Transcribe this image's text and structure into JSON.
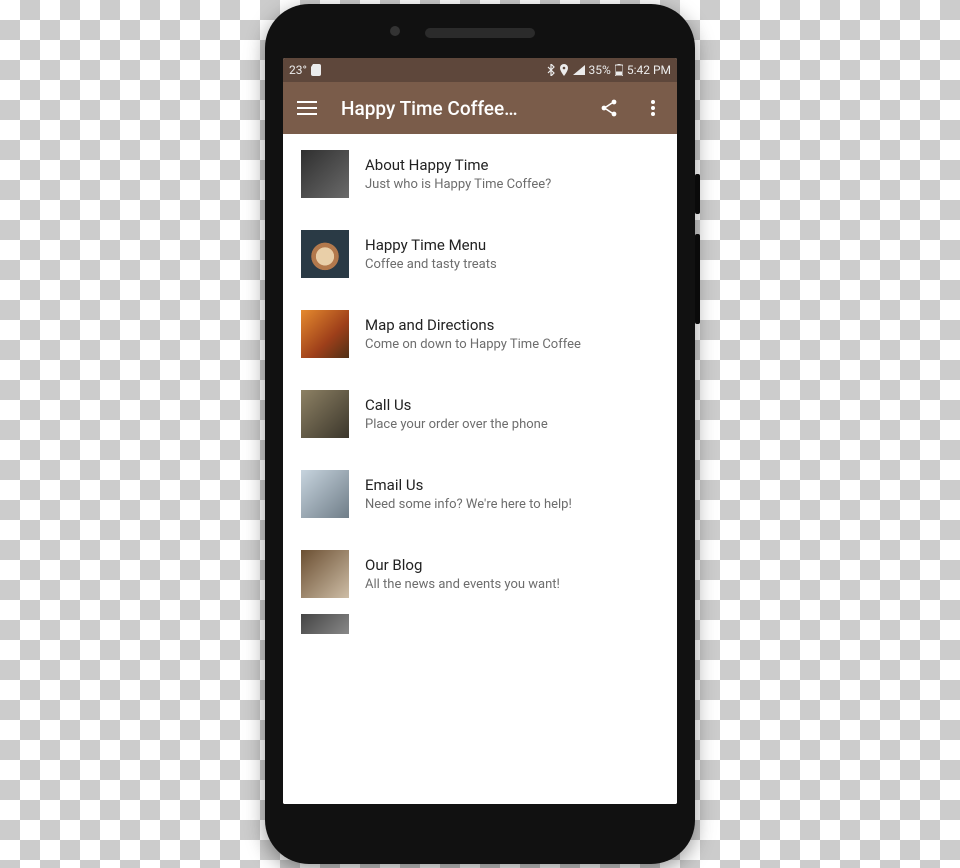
{
  "status_bar": {
    "temperature": "23°",
    "battery_percent": "35%",
    "clock": "5:42 PM"
  },
  "app_bar": {
    "title": "Happy Time Coffee…"
  },
  "menu": [
    {
      "title": "About Happy Time",
      "subtitle": "Just who is Happy Time Coffee?",
      "icon": "coffee-shop-photo"
    },
    {
      "title": "Happy Time Menu",
      "subtitle": "Coffee and tasty treats",
      "icon": "latte-photo"
    },
    {
      "title": "Map and Directions",
      "subtitle": "Come on down to Happy Time Coffee",
      "icon": "map-photo"
    },
    {
      "title": "Call Us",
      "subtitle": "Place your order over the phone",
      "icon": "keypad-photo"
    },
    {
      "title": "Email Us",
      "subtitle": "Need some info? We're here to help!",
      "icon": "laptop-photo"
    },
    {
      "title": "Our Blog",
      "subtitle": "All the news and events you want!",
      "icon": "blog-photo"
    }
  ]
}
